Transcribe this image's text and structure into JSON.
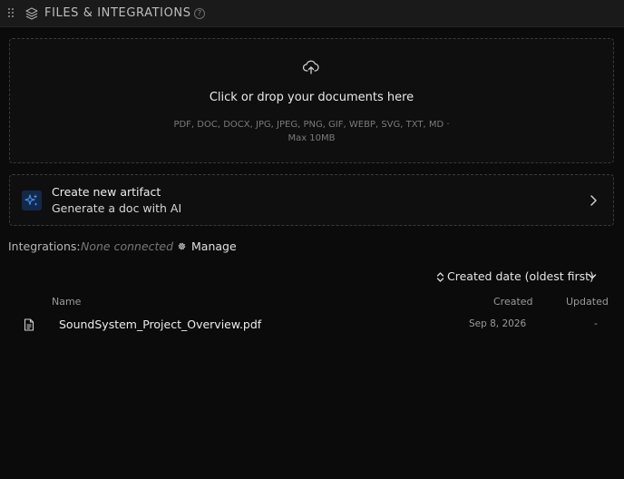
{
  "header": {
    "title": "FILES & INTEGRATIONS",
    "help_symbol": "?"
  },
  "dropzone": {
    "title": "Click or drop your documents here",
    "types_line1": "PDF, DOC, DOCX, JPG, JPEG, PNG, GIF, WEBP, SVG, TXT, MD ·",
    "types_line2": "Max 10MB"
  },
  "artifact": {
    "title": "Create new artifact",
    "subtitle": "Generate a doc with AI"
  },
  "integrations": {
    "label": "Integrations:",
    "status": "None connected",
    "manage_label": "Manage"
  },
  "sort": {
    "label": "Created date (oldest first)"
  },
  "table": {
    "columns": [
      "Name",
      "Created",
      "Updated"
    ],
    "rows": [
      {
        "name": "SoundSystem_Project_Overview.pdf",
        "created": "Sep 8, 2026",
        "updated": "-"
      }
    ]
  },
  "colors": {
    "background": "#0b0b0b",
    "header_bg": "#1a1a1a",
    "accent_blue": "#3b82f6"
  }
}
